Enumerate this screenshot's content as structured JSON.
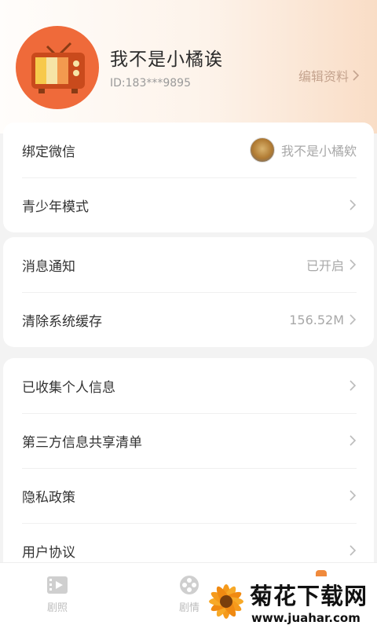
{
  "profile": {
    "name": "我不是小橘诶",
    "id": "ID:183***9895",
    "edit_label": "编辑资料"
  },
  "account_settings": [
    {
      "label": "绑定微信",
      "value": "我不是小橘欸"
    },
    {
      "label": "青少年模式",
      "value": ""
    }
  ],
  "app_settings": [
    {
      "label": "消息通知",
      "value": "已开启"
    },
    {
      "label": "清除系统缓存",
      "value": "156.52M"
    }
  ],
  "privacy_settings": [
    {
      "label": "已收集个人信息"
    },
    {
      "label": "第三方信息共享清单"
    },
    {
      "label": "隐私政策"
    },
    {
      "label": "用户协议"
    }
  ],
  "tabbar": [
    {
      "label": "剧照",
      "icon": "film-clip-icon"
    },
    {
      "label": "剧情",
      "icon": "film-reel-icon"
    }
  ],
  "watermark": {
    "title": "菊花下载网",
    "url": "www.juahar.com"
  },
  "colors": {
    "accent": "#ef6a3a",
    "edit_link": "#c4a38e",
    "tab_active_dot": "#f08a3c"
  }
}
